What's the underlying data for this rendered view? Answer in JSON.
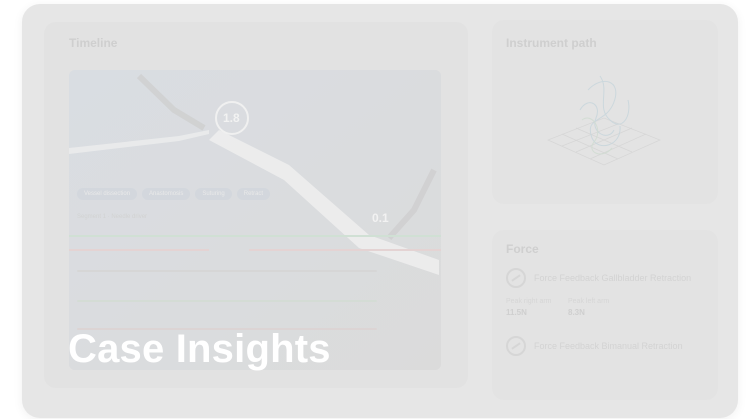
{
  "timeline": {
    "title": "Timeline"
  },
  "video": {
    "chips": [
      "Vessel dissection",
      "Anastomosis",
      "Suturing",
      "Retract"
    ],
    "track_label": "Segment 1 · Needle driver",
    "badges": [
      "1.8",
      "0.1"
    ]
  },
  "instrument_path": {
    "title": "Instrument path"
  },
  "force": {
    "title": "Force",
    "rows": [
      {
        "label": "Force Feedback Gallbladder Retraction",
        "metrics": [
          {
            "caption": "Peak right arm",
            "value": "11.5N"
          },
          {
            "caption": "Peak left arm",
            "value": "8.3N"
          }
        ]
      },
      {
        "label": "Force Feedback Bimanual Retraction",
        "metrics": []
      }
    ]
  },
  "hero": {
    "title": "Case Insights"
  },
  "colors": {
    "card_bg": "#e6e6e6",
    "overlay_text": "#ffffff"
  }
}
